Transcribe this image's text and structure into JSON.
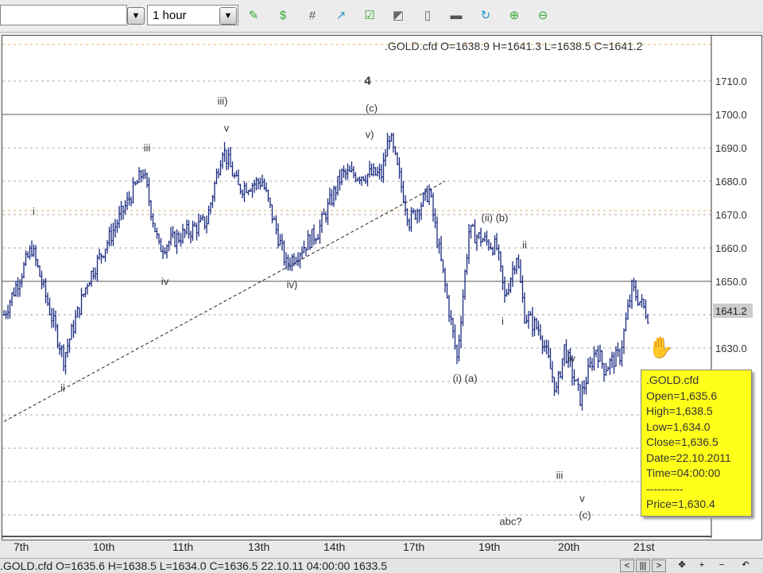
{
  "toolbar": {
    "symbol_value": "",
    "timeframe_value": "1 hour",
    "icons": [
      "add-indicator-icon",
      "add-symbol-icon",
      "grid-icon",
      "chart-type-icon",
      "draw-icon",
      "line-icon",
      "document-icon",
      "print-icon",
      "refresh-icon",
      "zoom-in-chart-icon",
      "zoom-out-chart-icon"
    ]
  },
  "chart_header": ".GOLD.cfd O=1638.9 H=1641.3 L=1638.5 C=1641.2",
  "status_bar": {
    "text": ".GOLD.cfd O=1635.6 H=1638.5 L=1634.0 C=1636.5   22.10.11 04:00:00  1633.5",
    "buttons": [
      "<",
      "|||",
      ">",
      "✥",
      "+",
      "−",
      "↶"
    ]
  },
  "tooltip": {
    "symbol": ".GOLD.cfd",
    "open": "Open=1,635.6",
    "high": "High=1,638.5",
    "low": "Low=1,634.0",
    "close": "Close=1,636.5",
    "date": "Date=22.10.2011",
    "time": "Time=04:00:00",
    "sep": "----------",
    "price": "Price=1,630.4"
  },
  "chart_data": {
    "type": "ohlc",
    "symbol": ".GOLD.cfd",
    "timeframe": "1 hour",
    "ylim": [
      1580,
      1720
    ],
    "y_ticks": [
      "1710.0",
      "1700.0",
      "1690.0",
      "1680.0",
      "1670.0",
      "1660.0",
      "1650.0",
      "1630.0"
    ],
    "current_price": "1641.2",
    "x_ticks": [
      {
        "label": "7th",
        "bar": 4
      },
      {
        "label": "10th",
        "bar": 24
      },
      {
        "label": "11th",
        "bar": 44
      },
      {
        "label": "13th",
        "bar": 63
      },
      {
        "label": "14th",
        "bar": 82
      },
      {
        "label": "17th",
        "bar": 102
      },
      {
        "label": "19th",
        "bar": 121
      },
      {
        "label": "20th",
        "bar": 141
      },
      {
        "label": "21st",
        "bar": 160
      }
    ],
    "price_path": [
      [
        0,
        1640
      ],
      [
        7,
        1660
      ],
      [
        15,
        1627
      ],
      [
        21,
        1650
      ],
      [
        35,
        1683
      ],
      [
        39,
        1660
      ],
      [
        51,
        1668
      ],
      [
        55,
        1690
      ],
      [
        59,
        1678
      ],
      [
        65,
        1680
      ],
      [
        71,
        1655
      ],
      [
        79,
        1665
      ],
      [
        85,
        1682
      ],
      [
        95,
        1682
      ],
      [
        97,
        1694
      ],
      [
        102,
        1668
      ],
      [
        107,
        1677
      ],
      [
        114,
        1627
      ],
      [
        117,
        1665
      ],
      [
        124,
        1660
      ],
      [
        126,
        1645
      ],
      [
        129,
        1658
      ],
      [
        131,
        1640
      ],
      [
        135,
        1635
      ],
      [
        139,
        1617
      ],
      [
        141,
        1630
      ],
      [
        145,
        1615
      ],
      [
        149,
        1630
      ],
      [
        151,
        1624
      ],
      [
        155,
        1628
      ],
      [
        158,
        1648
      ],
      [
        162,
        1640
      ]
    ],
    "trendline": [
      [
        0,
        1608
      ],
      [
        111,
        1680
      ]
    ],
    "wave_labels": [
      {
        "text": "i",
        "bar": 7.5,
        "price": 1671
      },
      {
        "text": "ii",
        "bar": 14.8,
        "price": 1618
      },
      {
        "text": "iii",
        "bar": 36,
        "price": 1690
      },
      {
        "text": "iv",
        "bar": 40.5,
        "price": 1650
      },
      {
        "text": "iii)",
        "bar": 55,
        "price": 1704
      },
      {
        "text": "v",
        "bar": 56,
        "price": 1696
      },
      {
        "text": "iv)",
        "bar": 72.5,
        "price": 1649
      },
      {
        "text": "4",
        "bar": 91.5,
        "price": 1710,
        "bold": true
      },
      {
        "text": "(c)",
        "bar": 92.5,
        "price": 1702
      },
      {
        "text": "v)",
        "bar": 92,
        "price": 1694
      },
      {
        "text": "(ii) (b)",
        "bar": 123.5,
        "price": 1669
      },
      {
        "text": "ii",
        "bar": 131,
        "price": 1661
      },
      {
        "text": "i",
        "bar": 125.5,
        "price": 1638
      },
      {
        "text": "(i) (a)",
        "bar": 116,
        "price": 1621
      },
      {
        "text": "iv",
        "bar": 142.8,
        "price": 1627
      },
      {
        "text": "iii",
        "bar": 139.8,
        "price": 1592
      },
      {
        "text": "v",
        "bar": 145.5,
        "price": 1585
      },
      {
        "text": "(c)",
        "bar": 146.2,
        "price": 1580
      },
      {
        "text": "abc?",
        "bar": 127.5,
        "price": 1578
      }
    ]
  }
}
